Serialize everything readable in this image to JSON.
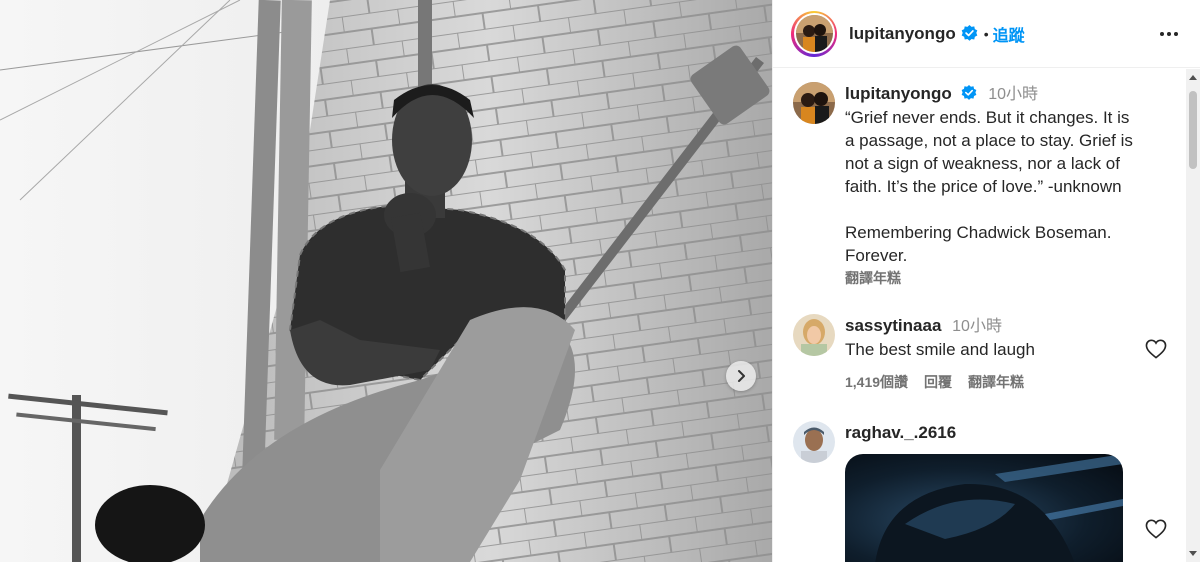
{
  "post": {
    "author": "lupitanyongo",
    "follow_label": "追蹤",
    "separator": "•"
  },
  "caption": {
    "username": "lupitanyongo",
    "time": "10小時",
    "lines": [
      "“Grief never ends. But it changes. It is",
      "a passage, not a place to stay. Grief is",
      "not a sign of weakness, nor a lack of",
      "faith. It’s the price of love.” -unknown",
      "",
      "Remembering Chadwick Boseman.",
      "Forever."
    ],
    "translate_label": "翻譯年糕"
  },
  "comments": [
    {
      "username": "sassytinaaa",
      "time": "10小時",
      "text": "The best smile and laugh",
      "likes": "1,419個讚",
      "reply_label": "回覆",
      "translate_label": "翻譯年糕"
    },
    {
      "username": "raghav._.2616",
      "time": "",
      "text": ""
    }
  ],
  "icons": {
    "verified": "verified-badge-icon",
    "more": "more-options-icon",
    "heart": "heart-icon",
    "next": "chevron-right-icon"
  },
  "colors": {
    "accent": "#0095f6",
    "text": "#262626",
    "muted": "#737373"
  }
}
